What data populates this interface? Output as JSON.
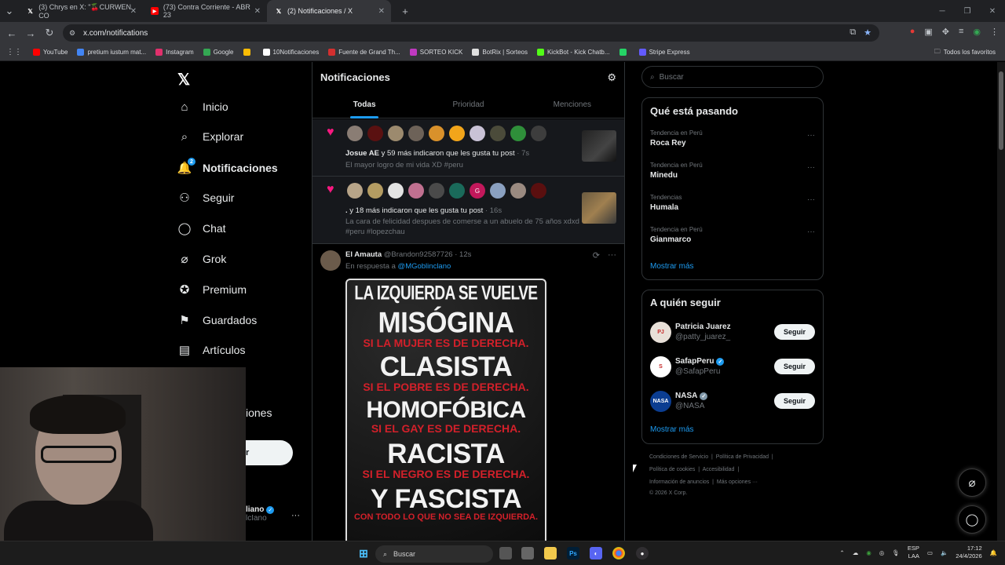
{
  "browser": {
    "tabs": [
      {
        "title": "(3) Chrys en X: \"🍒CURWEN CO",
        "icon": "x-icon"
      },
      {
        "title": "(73) Contra Corriente - ABR 23",
        "icon": "youtube-icon"
      },
      {
        "title": "(2) Notificaciones / X",
        "icon": "x-icon",
        "active": true
      }
    ],
    "url": "x.com/notifications",
    "bookmarks": [
      {
        "label": "YouTube",
        "color": "#ff0000"
      },
      {
        "label": "pretium iustum mat...",
        "color": "#4285f4"
      },
      {
        "label": "Instagram",
        "color": "#e1306c"
      },
      {
        "label": "Google",
        "color": "#34a853"
      },
      {
        "label": "",
        "color": "#fbbc05"
      },
      {
        "label": "10Notificaciones",
        "color": "#ffffff"
      },
      {
        "label": "Fuente de Grand Th...",
        "color": "#d32f2f"
      },
      {
        "label": "SORTEO KICK",
        "color": "#c039c0"
      },
      {
        "label": "BotRix | Sorteos",
        "color": "#e0e0e0"
      },
      {
        "label": "KickBot - Kick Chatb...",
        "color": "#53fc18"
      },
      {
        "label": "",
        "color": "#25d366"
      },
      {
        "label": "Stripe Express",
        "color": "#635bff"
      }
    ],
    "all_bookmarks": "Todos los favoritos"
  },
  "nav": {
    "items": [
      {
        "label": "Inicio",
        "icon": "home-icon"
      },
      {
        "label": "Explorar",
        "icon": "search-icon"
      },
      {
        "label": "Notificaciones",
        "icon": "bell-icon",
        "badge": "2"
      },
      {
        "label": "Seguir",
        "icon": "follow-icon"
      },
      {
        "label": "Chat",
        "icon": "chat-icon"
      },
      {
        "label": "Grok",
        "icon": "grok-icon"
      },
      {
        "label": "Premium",
        "icon": "premium-icon"
      },
      {
        "label": "Guardados",
        "icon": "bookmark-icon"
      },
      {
        "label": "Artículos",
        "icon": "articles-icon"
      }
    ],
    "partial_more": "iones",
    "partial_post": "r",
    "partial_user": "liano",
    "partial_handle": "lcIano"
  },
  "main": {
    "title": "Notificaciones",
    "tabs": [
      "Todas",
      "Prioridad",
      "Menciones"
    ],
    "notifications": [
      {
        "actor": "Josue AE",
        "action": " y 59 más indicaron que les gusta tu post",
        "time": " · 7s",
        "snippet": "El mayor logro de mi vida XD #peru"
      },
      {
        "actor": ".",
        "action": " y 18 más indicaron que les gusta tu post",
        "time": " · 16s",
        "snippet": "La cara de felicidad despues de comerse a un abuelo de 75 años xdxd #peru #lopezchau"
      }
    ],
    "tweet": {
      "name": "El Amauta",
      "handle": "@Brandon92587726",
      "time": " · 12s",
      "reply_prefix": "En respuesta a ",
      "reply_to": "@MGoblinclano",
      "poster": {
        "line1": "LA IZQUIERDA SE VUELVE",
        "w1": "MISÓGINA",
        "r1": "SI LA MUJER ES DE DERECHA.",
        "w2": "CLASISTA",
        "r2": "SI EL POBRE ES DE DERECHA.",
        "w3": "HOMOFÓBICA",
        "r3": "SI EL GAY ES DE DERECHA.",
        "w4": "RACISTA",
        "r4": "SI EL NEGRO ES DE DERECHA.",
        "w5": "Y FASCISTA",
        "r5": "CON TODO LO QUE NO SEA DE IZQUIERDA."
      }
    }
  },
  "right": {
    "search_placeholder": "Buscar",
    "trending_title": "Qué está pasando",
    "trends": [
      {
        "context": "Tendencia en Perú",
        "name": "Roca Rey"
      },
      {
        "context": "Tendencia en Perú",
        "name": "Minedu"
      },
      {
        "context": "Tendencias",
        "name": "Humala"
      },
      {
        "context": "Tendencia en Perú",
        "name": "Gianmarco"
      }
    ],
    "show_more": "Mostrar más",
    "follow_title": "A quién seguir",
    "follow": [
      {
        "name": "Patricia Juarez",
        "handle": "@patty_juarez_",
        "verified": false,
        "avatar_color": "#e8e0d8",
        "avatar_text": "PJ"
      },
      {
        "name": "SafapPeru",
        "handle": "@SafapPeru",
        "verified": true,
        "avatar_color": "#ffffff",
        "avatar_text": "S"
      },
      {
        "name": "NASA",
        "handle": "@NASA",
        "verified": true,
        "gray": true,
        "avatar_color": "#0b3d91",
        "avatar_text": "NASA"
      }
    ],
    "follow_button": "Seguir",
    "footer": {
      "line1a": "Condiciones de Servicio",
      "line1b": "Política de Privacidad",
      "line2a": "Política de cookies",
      "line2b": "Accesibilidad",
      "line3a": "Información de anuncios",
      "line3b": "Más opciones ···",
      "copyright": "© 2026 X Corp."
    }
  },
  "taskbar": {
    "search": "Buscar",
    "lang1": "ESP",
    "lang2": "LAA",
    "time": "17:12",
    "date": "24/4/2026"
  }
}
